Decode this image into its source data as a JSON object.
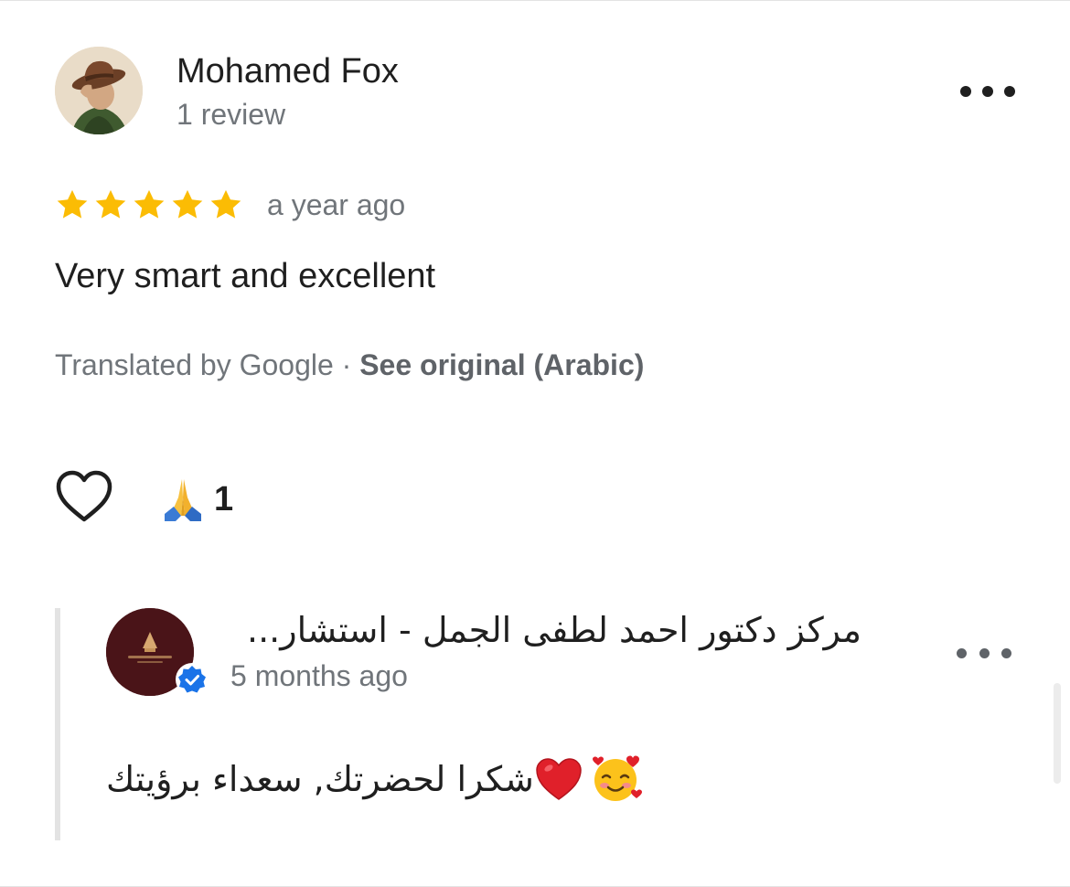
{
  "review": {
    "author_name": "Mohamed Fox",
    "author_meta": "1 review",
    "rating": 5,
    "rating_max": 5,
    "date": "a year ago",
    "text": "Very smart and excellent",
    "translated_by": "Translated by Google",
    "separator": "·",
    "see_original": "See original (Arabic)",
    "more_icon": "more-horizontal-icon",
    "star_color": "#fbbc04"
  },
  "reactions": {
    "like_icon": "heart-outline-icon",
    "reaction_icon": "folded-hands-emoji",
    "reaction_count": "1"
  },
  "owner_reply": {
    "owner_name": "مركز دكتور احمد لطفى الجمل - استشار...",
    "date": "5 months ago",
    "text_arabic": "شكرا لحضرتك, سعداء برؤيتك",
    "emojis": [
      "red-heart-emoji",
      "smiling-face-with-hearts-emoji"
    ],
    "verified_color": "#1a73e8",
    "avatar_color": "#4a1418"
  }
}
